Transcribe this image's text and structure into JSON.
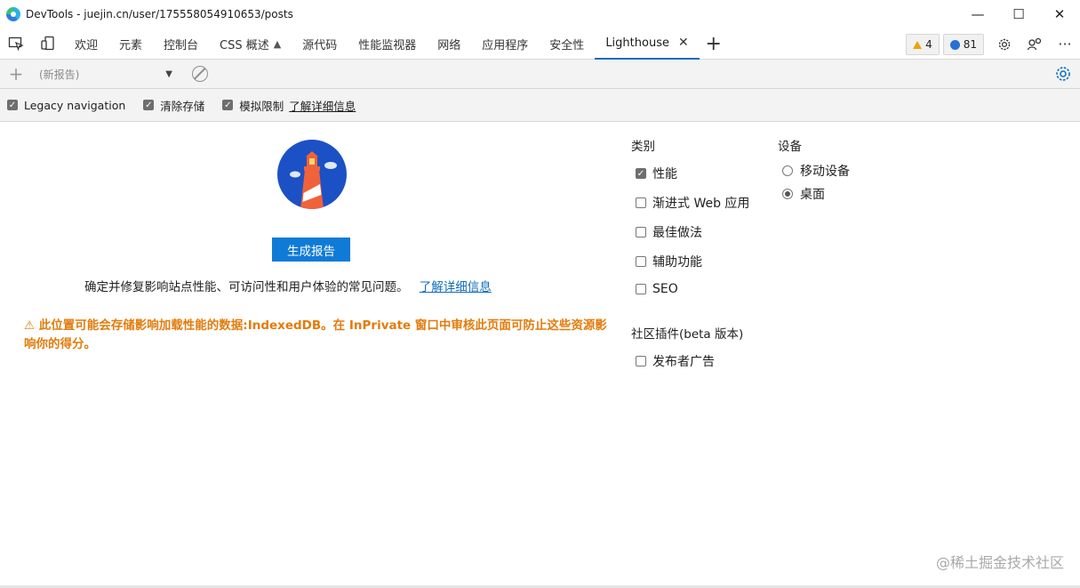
{
  "window": {
    "title": "DevTools - juejin.cn/user/175558054910653/posts",
    "minimize": "—",
    "maximize": "☐",
    "close": "✕"
  },
  "tabs": [
    {
      "label": "欢迎"
    },
    {
      "label": "元素"
    },
    {
      "label": "控制台"
    },
    {
      "label": "CSS 概述"
    },
    {
      "label": "源代码"
    },
    {
      "label": "性能监视器"
    },
    {
      "label": "网络"
    },
    {
      "label": "应用程序"
    },
    {
      "label": "安全性"
    },
    {
      "label": "Lighthouse",
      "active": true
    }
  ],
  "badges": {
    "warnings": "4",
    "messages": "81"
  },
  "toolbar": {
    "report_placeholder": "(新报告)"
  },
  "options": {
    "legacy_navigation": "Legacy navigation",
    "clear_storage": "清除存储",
    "simulate_throttling": "模拟限制",
    "learn_more": "了解详细信息"
  },
  "main": {
    "generate_button": "生成报告",
    "description": "确定并修复影响站点性能、可访问性和用户体验的常见问题。",
    "learn_more": "了解详细信息",
    "warning": "⚠  此位置可能会存储影响加载性能的数据:IndexedDB。在 InPrivate 窗口中审核此页面可防止这些资源影响你的得分。"
  },
  "categories": {
    "title": "类别",
    "items": [
      {
        "label": "性能",
        "checked": true
      },
      {
        "label": "渐进式 Web 应用",
        "checked": false
      },
      {
        "label": "最佳做法",
        "checked": false
      },
      {
        "label": "辅助功能",
        "checked": false
      },
      {
        "label": "SEO",
        "checked": false
      }
    ]
  },
  "device": {
    "title": "设备",
    "options": [
      {
        "label": "移动设备",
        "selected": false
      },
      {
        "label": "桌面",
        "selected": true
      }
    ]
  },
  "community": {
    "title": "社区插件(beta 版本)",
    "items": [
      {
        "label": "发布者广告",
        "checked": false
      }
    ]
  },
  "watermark": "@稀土掘金技术社区",
  "colors": {
    "accent": "#0f6cbd",
    "button": "#0f7bd6",
    "warning": "#e27c0c",
    "lighthouse_bg": "#1c51c5"
  }
}
